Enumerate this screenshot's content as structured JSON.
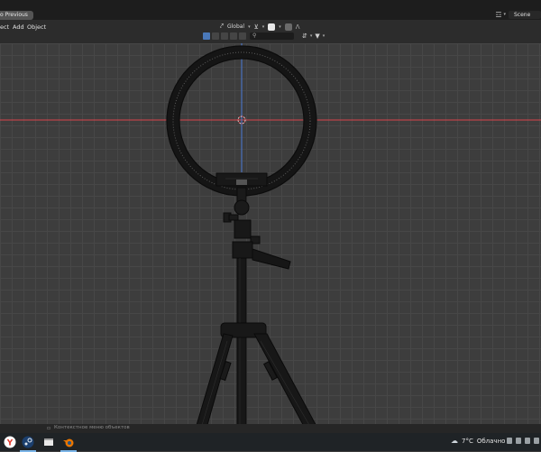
{
  "topbar": {
    "back_label": "o Previous",
    "scene_label": "Scene"
  },
  "header": {
    "menus": [
      "ect",
      "Add",
      "Object"
    ],
    "orientation": "Global",
    "search_placeholder": ""
  },
  "status_bar": {
    "hint": "Контекстное меню объектов"
  },
  "taskbar": {
    "weather_temp": "7°C",
    "weather_desc": "Облачно"
  },
  "colors": {
    "x_axis": "#d9444c",
    "y_axis": "#4a7ad8",
    "grid": "#474747",
    "background": "#3d3d3d",
    "wire": "#121212",
    "selection": "#4a78b8"
  },
  "icons": [
    "layout-icon",
    "scene-icon",
    "snap-icon",
    "proportional-icon",
    "search-icon",
    "filter-icon",
    "yandex-browser-icon",
    "steam-icon",
    "file-explorer-icon",
    "blender-icon",
    "cloud-icon"
  ]
}
